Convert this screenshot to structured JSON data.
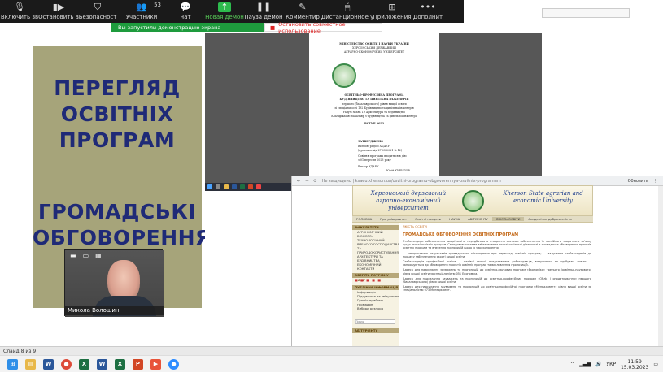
{
  "zoom_toolbar": {
    "items": [
      {
        "label": "Включить зв",
        "icon": "microphone-muted-icon"
      },
      {
        "label": "Остановить в",
        "icon": "video-icon"
      },
      {
        "label": "Безопасност",
        "icon": "shield-icon"
      },
      {
        "label": "Участники",
        "icon": "participants-icon",
        "count": "53"
      },
      {
        "label": "Чат",
        "icon": "chat-icon"
      },
      {
        "label": "Новая демон",
        "icon": "share-screen-icon"
      },
      {
        "label": "Пауза демон",
        "icon": "pause-icon"
      },
      {
        "label": "Комментир",
        "icon": "annotate-icon"
      },
      {
        "label": "Дистанционное у",
        "icon": "remote-control-icon"
      },
      {
        "label": "Приложения",
        "icon": "apps-icon"
      },
      {
        "label": "Дополнит",
        "icon": "more-icon"
      }
    ]
  },
  "share_banner": {
    "sharing_text": "Вы запустили демонстрацию экрана",
    "stop_text": "Остановить совместное использование"
  },
  "slide": {
    "title_1": "ПЕРЕГЛЯД ОСВІТНІХ ПРОГРАМ",
    "title_2": "ГРОМАДСЬКІ ОБГОВОРЕННЯ"
  },
  "webcam": {
    "name": "Микола Волошин"
  },
  "document": {
    "lines": [
      "МІНІСТЕРСТВО ОСВІТИ І НАУКИ УКРАЇНИ",
      "ХЕРСОНСЬКИЙ ДЕРЖАВНИЙ",
      "АГРАРНО-ЕКОНОМІЧНИЙ УНІВЕРСИТЕТ"
    ],
    "program_lines": [
      "ОСВІТНЬО-ПРОФЕСІЙНА ПРОГРАМА",
      "БУДІВНИЦТВО ТА ЦИВІЛЬНА ІНЖЕНЕРІЯ",
      "першого (бакалаврського) рівня вищої освіти",
      "зі спеціальності 192 Будівництво та цивільна інженерія",
      "галузі знань 19 Архітектура та будівництво",
      "Кваліфікація: бакалавр з будівництва та цивільної інженерії",
      "ВСТУП 2023"
    ],
    "approve_lines": [
      "ЗАТВЕРДЖЕНО",
      "Вченою радою ХДАЕУ",
      "(протокол від 27.05.2021 № 12)",
      "Освітня програма вводиться в дію",
      "з 01 вересня 2023 року",
      "Ректор ХДАЕУ",
      "Юрій КИРИЛОВ"
    ]
  },
  "browser": {
    "url": "Не защищено | ksaeu.kherson.ua/osvitni-programu-obgovorennya-osvitnix-programam",
    "right_tab": "Обновить",
    "site": {
      "name_ua": "Херсонський державний аграрно-економічний університет",
      "name_en": "Kherson State agrarian and economic University",
      "nav": [
        "ГОЛОВНА",
        "Про університет",
        "Освітні процеси",
        "НАУКА",
        "АБІТУРІЄНТУ",
        "ЯКІСТЬ ОСВІТИ",
        "Академічна доброчесність"
      ],
      "nav_active_index": 5,
      "sidebar_head_1": "ФАКУЛЬТЕТИ",
      "sidebar_items_1": [
        "АГРОНОМІЧНИЙ",
        "БІОЛОГО-ТЕХНОЛОГІЧНИЙ",
        "РИБНОГО ГОСПОДАРСТВА ТА ПРИРОДОКОРИСТУВАННЯ",
        "АРХІТЕКТУРИ ТА БУДІВНИЦТВА",
        "ЕКОНОМІЧНИЙ",
        "КОНТАКТИ"
      ],
      "sidebar_head_2": "ОБЕРІТЬ ПОТРІБНУ МОВУ",
      "flags": "■ ■ ■ ■ ■",
      "sidebar_head_3": "ПУБЛІЧНА ІНФОРМАЦІЯ",
      "sidebar_items_3": [
        "Інформація",
        "Підсумкова та звітування",
        "Графік прийому громадян",
        "Вибори ректора"
      ],
      "search_placeholder": "Пошук",
      "sidebar_head_4": "АБІТУРІЄНТУ",
      "crumb": "ЯКІСТЬ ОСВІТИ",
      "title": "ГРОМАДСЬКЕ ОБГОВОРЕННЯ ОСВІТНІХ ПРОГРАМ",
      "paragraphs": [
        "Стейкголдери забезпечення вищої освіти передбачають створення системи забезпечення їх постійного зворотного зв’язку щодо якості освітніх програм. Складовою системи забезпечення якості освітньої діяльності є громадське обговорення проєктів освітніх програм та внесення пропозицій щодо їх удосконалення.",
        "— використання результатів громадського обговорення при перегляді освітніх програм; — залучення стейкголдерів до процесу забезпечення якості вищої освіти.",
        "Стейкголдерів професійної освіти — фахівці галузі, представники роботодавців, випускники та здобувачі освіти — запрошуються до обговорення проєктів освітніх програм та висловлення пропозицій.",
        "Адреса для надсилання зауважень та пропозицій до освітньо-наукових програм «Економіка» третього (освітньо-наукового) рівня вищої освіти за спеціальністю 051 Економіка.",
        "Адреса для надсилання зауважень та пропозицій до освітньо-професійних програм «Облік і оподаткування» першого (бакалаврського) рівня вищої освіти.",
        "Адреса для надсилання зауважень та пропозицій до освітньо-професійної програми «Менеджмент» рівня вищої освіти за спеціальністю 073 Менеджмент."
      ]
    }
  },
  "slide_status": "Слайд 8 из 9",
  "taskbar": {
    "language": "УКР",
    "time": "11:59",
    "date": "15.03.2023"
  },
  "colors": {
    "slide_bg": "#a6a47a",
    "slide_title": "#1f2a77",
    "banner_green": "#1e9b3d",
    "banner_red": "#dd2222"
  }
}
